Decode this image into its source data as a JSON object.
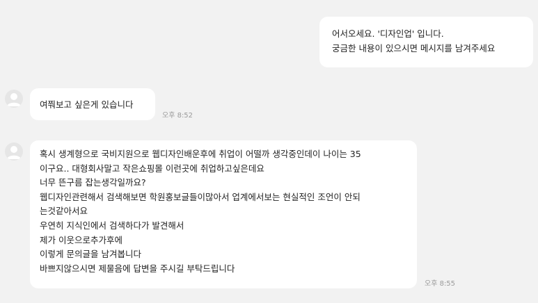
{
  "messages": [
    {
      "sender": "business",
      "lines": [
        "어서오세요. '디자인업' 입니다.",
        "궁금한 내용이 있으시면 메시지를 남겨주세요"
      ]
    },
    {
      "sender": "user",
      "lines": [
        "여쭤보고 싶은게 있습니다"
      ],
      "time": "오후 8:52"
    },
    {
      "sender": "user",
      "lines": [
        "혹시 생계형으로 국비지원으로 웹디자인배운후에 취업이 어떨까 생각중인데이 나이는 35",
        "이구요.. 대형회사말고 작은쇼핑몰 이런곳에 취업하고싶은데요",
        "너무 뜬구름 잡는생각일까요?",
        "웹디자인관련해서 검색해보면 학원홍보글들이많아서 업계에서보는 현실적인 조언이 안되",
        "는것같아서요",
        "우연히 지식인에서 검색하다가 발견해서",
        "제가 이웃으로추가후에",
        "이렇게 문의글을 남겨봅니다",
        "바쁘지않으시면 제물음에 답변을 주시길 부탁드립니다"
      ],
      "time": "오후 8:55"
    }
  ],
  "icons": {
    "avatar": "default-user-avatar-icon"
  }
}
